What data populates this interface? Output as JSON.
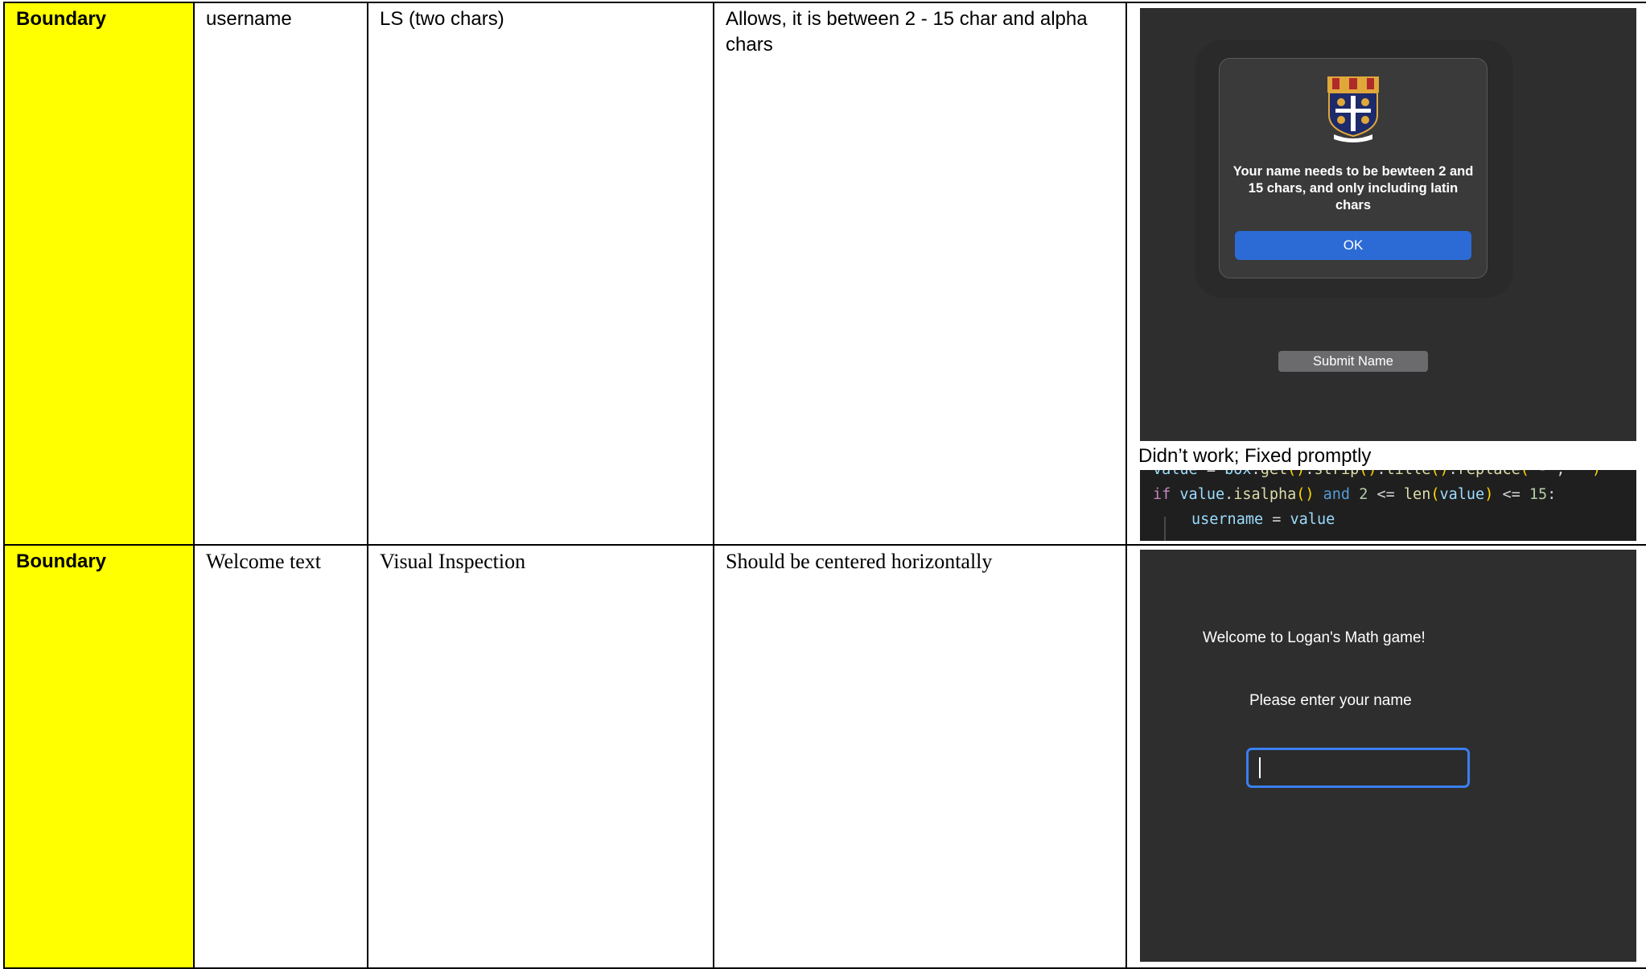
{
  "table": {
    "rows": [
      {
        "test_type": "Boundary",
        "field": "username",
        "test_data": "LS (two chars)",
        "expected": "Allows, it is between 2 - 15 char and alpha chars",
        "evidence": {
          "dialog": {
            "message": "Your name needs to be bewteen 2 and 15 chars, and only including latin chars",
            "ok_label": "OK",
            "crest_icon": "school-crest-icon"
          },
          "submit_label": "Submit Name",
          "note": "Didn’t work; Fixed promptly",
          "code": {
            "line1": "value = box.get().strip().title().replace(\"-\", \"\")",
            "line2": "if value.isalpha() and 2 <= len(value) <= 15:",
            "line3": "username = value"
          }
        }
      },
      {
        "test_type": "Boundary",
        "field": "Welcome text",
        "test_data": "Visual Inspection",
        "expected": "Should be centered horizontally",
        "evidence": {
          "welcome": "Welcome to Logan's Math game!",
          "prompt": "Please enter your name",
          "input_value": ""
        }
      }
    ]
  },
  "colors": {
    "type_cell": "#ffff00",
    "app_background": "#2e2e2f",
    "accent_button": "#2c6bd6",
    "input_focus": "#3a7ff0"
  }
}
